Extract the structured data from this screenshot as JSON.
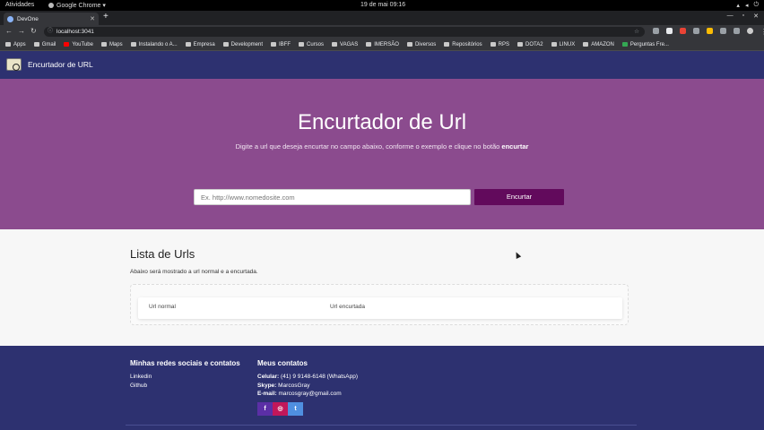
{
  "os": {
    "activities": "Atividades",
    "app_name": "Google Chrome ▾",
    "clock": "19 de mai 09:16"
  },
  "browser": {
    "tab_title": "DevOne",
    "url": "localhost:3041",
    "bookmarks": [
      "Apps",
      "Gmail",
      "YouTube",
      "Maps",
      "Instalando o A...",
      "Empresa",
      "Development",
      "IBFF",
      "Cursos",
      "VAGAS",
      "IMERSÃO",
      "Diversos",
      "Repositórios",
      "RPS",
      "DOTA2",
      "LINUX",
      "AMAZON",
      "Perguntas Fre..."
    ]
  },
  "nav": {
    "brand": "Encurtador de URL"
  },
  "hero": {
    "title": "Encurtador de Url",
    "subtitle_pre": "Digite a url que deseja encurtar no campo abaixo, conforme o exemplo e clique no botão ",
    "subtitle_bold": "encurtar",
    "input_placeholder": "Ex. http://www.nomedosite.com",
    "button": "Encurtar"
  },
  "list": {
    "title": "Lista de Urls",
    "subtitle": "Abaixo será mostrado a url normal e a encurtada.",
    "columns": [
      "Url normal",
      "Url encurtada"
    ]
  },
  "footer": {
    "social_heading": "Minhas redes sociais e contatos",
    "social_links": [
      "Linkedin",
      "Github"
    ],
    "contacts_heading": "Meus contatos",
    "contacts": [
      {
        "label": "Celular:",
        "value": " (41) 9 9148-6148 (WhatsApp)"
      },
      {
        "label": "Skype:",
        "value": " MarcosGray"
      },
      {
        "label": "E-mail:",
        "value": " marcosgray@gmail.com"
      }
    ],
    "social_buttons": [
      "f",
      "◎",
      "t"
    ]
  },
  "colors": {
    "nav": "#2d3170",
    "hero": "#8b4b8e",
    "button": "#620a5c",
    "footer": "#2d3170"
  }
}
